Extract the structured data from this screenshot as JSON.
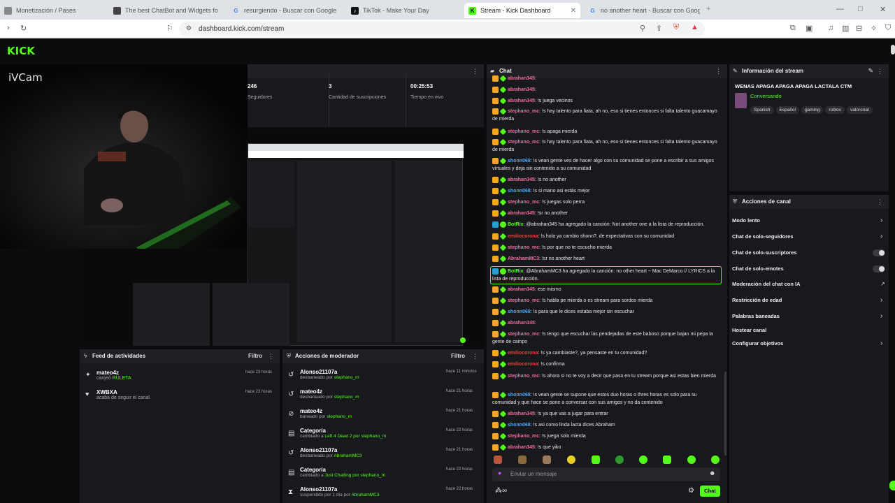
{
  "browser": {
    "tabs": [
      {
        "label": "Monetización / Pases",
        "active": false
      },
      {
        "label": "The best ChatBot and Widgets fo",
        "active": false
      },
      {
        "label": "resurgiendo - Buscar con Google",
        "active": false
      },
      {
        "label": "TikTok - Make Your Day",
        "active": false
      },
      {
        "label": "Stream - Kick Dashboard",
        "active": true
      },
      {
        "label": "no another heart - Buscar con Goog",
        "active": false
      }
    ],
    "url": "dashboard.kick.com/stream"
  },
  "brand": {
    "logo": "KICK",
    "accent": "#53fc18"
  },
  "webcam": {
    "label": "iVCam"
  },
  "stats": [
    {
      "value": "246",
      "label": "Seguidores"
    },
    {
      "value": "3",
      "label": "Cantidad de suscripciones"
    },
    {
      "value": "00:25:53",
      "label": "Tiempo en vivo"
    }
  ],
  "activity_feed": {
    "title": "Feed de actividades",
    "filter": "Filtro",
    "items": [
      {
        "user": "mateo4z",
        "desc_prefix": "canjeó",
        "desc_highlight": "RULETA",
        "time": "hace 23 horas"
      },
      {
        "user": "XWBXA",
        "desc_prefix": "acaba de seguir el canal",
        "desc_highlight": "",
        "time": "hace 23 horas"
      }
    ]
  },
  "mod_actions": {
    "title": "Acciones de moderador",
    "filter": "Filtro",
    "items": [
      {
        "title": "Alonso21107a",
        "desc": "desbaneado por",
        "by": "stephano_m",
        "time": "hace 11 minutos"
      },
      {
        "title": "mateo4z",
        "desc": "desbaneado por",
        "by": "stephano_m",
        "time": "hace 21 horas"
      },
      {
        "title": "mateo4z",
        "desc": "baneado por",
        "by": "stephano_m",
        "time": "hace 21 horas"
      },
      {
        "title": "Categoría",
        "desc": "cambiado a",
        "by": "Left 4 Dead 2 por stephano_m",
        "time": "hace 22 horas"
      },
      {
        "title": "Alonso21107a",
        "desc": "desbaneado por",
        "by": "AbrahamMC3",
        "time": "hace 21 horas"
      },
      {
        "title": "Categoría",
        "desc": "cambiado a",
        "by": "Just Chatting por stephano_m",
        "time": "hace 22 horas"
      },
      {
        "title": "Alonso21107a",
        "desc": "suspendido por 1 día por",
        "by": "AbrahamMC3",
        "time": "hace 22 horas"
      }
    ]
  },
  "chat": {
    "title": "Chat",
    "input_placeholder": "Enviar un mensaje",
    "send_label": "Chat",
    "messages": [
      {
        "user": "abrahan345",
        "color": "#f06aa5",
        "text": ""
      },
      {
        "user": "abrahan345",
        "color": "#f06aa5",
        "text": ""
      },
      {
        "user": "abrahan345",
        "color": "#f06aa5",
        "text": "!s juega vecinos"
      },
      {
        "user": "stephano_mc",
        "color": "#f06aa5",
        "text": "!s hay talento para fiata, ah no, eso si tienes entonces si falta talento guacamayo de mierda"
      },
      {
        "user": "stephano_mc",
        "color": "#f06aa5",
        "text": "!s apaga mierda"
      },
      {
        "user": "stephano_mc",
        "color": "#f06aa5",
        "text": "!s hay talento para fiata, ah no, eso si tienes entonces si falta talento guacamayo de mierda"
      },
      {
        "user": "shonn068",
        "color": "#4aa8ff",
        "text": "!s vean gente ves de hacer algo con su comunidad se pone a escribir a sus amigos virtuales y deja sin contenido a su comunidad"
      },
      {
        "user": "abrahan345",
        "color": "#f06aa5",
        "text": "!s no another"
      },
      {
        "user": "shonn068",
        "color": "#4aa8ff",
        "text": "!s si mano asi estás mejor"
      },
      {
        "user": "stephano_mc",
        "color": "#f06aa5",
        "text": "!s juegas solo perra"
      },
      {
        "user": "abrahan345",
        "color": "#f06aa5",
        "text": "!sr no another"
      },
      {
        "user": "BotRix",
        "color": "#53fc18",
        "text": "@abrahan345 ha agregado la canción: Not another one a la lista de reproducción."
      },
      {
        "user": "emiliocorona",
        "color": "#e0443a",
        "text": "!s hola ya cambio shonn?, de expectativas con su comunidad"
      },
      {
        "user": "stephano_mc",
        "color": "#f06aa5",
        "text": "!s por que no te escucho mierda"
      },
      {
        "user": "AbrahamMC3",
        "color": "#f06aa5",
        "text": "!sr no another heart"
      },
      {
        "user": "BotRix",
        "color": "#53fc18",
        "text": "@AbrahamMC3 ha agregado la canción: no other heart ~ Mac DeMarco // LYRICS a la lista de reproducción."
      },
      {
        "user": "abrahan345",
        "color": "#f06aa5",
        "text": "ese mismo"
      },
      {
        "user": "stephano_mc",
        "color": "#f06aa5",
        "text": "!s habla pe mierda o es stream para sordos mierda"
      },
      {
        "user": "shonn068",
        "color": "#4aa8ff",
        "text": "!s para que le dices estaba mejor sin escuchar"
      },
      {
        "user": "abrahan345",
        "color": "#f06aa5",
        "text": ""
      },
      {
        "user": "stephano_mc",
        "color": "#f06aa5",
        "text": "!s tengo que escuchar las pendejadas de este baboso porque bajan mi pepa la gente de campo"
      },
      {
        "user": "emiliocorona",
        "color": "#e0443a",
        "text": "!s ya cambiaste?, ya pensaste en tu comunidad?"
      },
      {
        "user": "emiliocorona",
        "color": "#e0443a",
        "text": "!s confirma"
      },
      {
        "user": "stephano_mc",
        "color": "#f06aa5",
        "text": "!s ahora si no te voy a decir que paso en tu stream porque asi estas bien mierda"
      },
      {
        "user": "shonn068",
        "color": "#4aa8ff",
        "text": "!s vean gente se supone que estos duo horas o thres horas es solo para su comunidad y que hace se pone a conversar con sus amigos y no da contenido"
      },
      {
        "user": "abrahan345",
        "color": "#f06aa5",
        "text": "!s ya que vas a jugar para entrar"
      },
      {
        "user": "shonn068",
        "color": "#4aa8ff",
        "text": "!s asi como linda lacta dices Abraham"
      },
      {
        "user": "stephano_mc",
        "color": "#f06aa5",
        "text": "!s juega solo mierda"
      },
      {
        "user": "abrahan345",
        "color": "#f06aa5",
        "text": "!s que yiko"
      }
    ]
  },
  "stream_info": {
    "title": "Información del stream",
    "stream_title": "WENAS APAGA APAGA APAGA LACTALA CTM",
    "category": "Conversando",
    "tags": [
      "Spanish",
      "Español",
      "gaming",
      "roblox",
      "valoronat"
    ]
  },
  "channel_actions": {
    "title": "Acciones de canal",
    "items": [
      {
        "label": "Modo lento",
        "control": "chevron"
      },
      {
        "label": "Chat de solo-seguidores",
        "control": "chevron"
      },
      {
        "label": "Chat de solo-suscriptores",
        "control": "toggle"
      },
      {
        "label": "Chat de solo-emotes",
        "control": "toggle"
      },
      {
        "label": "Moderación del chat con IA",
        "control": "external"
      },
      {
        "label": "Restricción de edad",
        "control": "chevron"
      },
      {
        "label": "Palabras baneadas",
        "control": "chevron"
      },
      {
        "label": "Hostear canal",
        "control": "none"
      },
      {
        "label": "Configurar objetivos",
        "control": "chevron"
      }
    ]
  }
}
